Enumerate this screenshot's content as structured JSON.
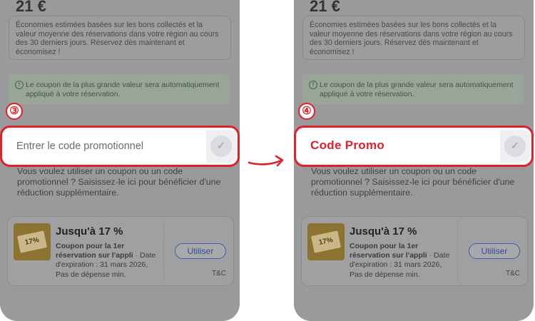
{
  "price": "21 €",
  "savings_text": "Économies estimées basées sur les bons collectés et la valeur moyenne des réservations dans votre région au cours des 30 derniers jours. Réservez dès maintenant et économisez !",
  "notice_icon": "!",
  "notice_text": "Le coupon de la plus grande valeur sera automatiquement appliqué à votre réservation.",
  "steps": {
    "left": "③",
    "right": "④"
  },
  "promo": {
    "left_placeholder": "Entrer le code promotionnel",
    "right_value": "Code Promo",
    "check_icon": "✓"
  },
  "hint_text": "Vous voulez utiliser un coupon ou un code promotionnel ? Saisissez-le ici pour bénéficier d'une réduction supplémentaire.",
  "coupon": {
    "title": "Jusqu'à 17 %",
    "desc_bold": "Coupon pour la 1er réservation sur l'appli",
    "desc_rest": " · Date d'expiration : 31 mars 2026, Pas de dépense min.",
    "ticket_label": "17%",
    "button": "Utiliser",
    "tc": "T&C"
  },
  "colors": {
    "accent": "#e0202a",
    "overlay": "#9a9a9c",
    "link": "#2c4f9b"
  }
}
